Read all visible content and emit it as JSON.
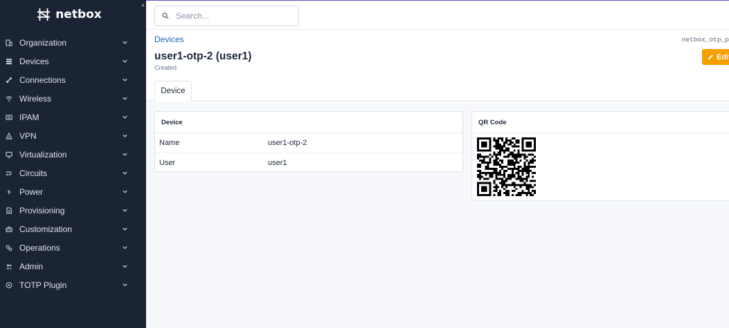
{
  "brand": {
    "name": "netbox"
  },
  "sidebar": {
    "items": [
      {
        "label": "Organization",
        "icon": "building-icon"
      },
      {
        "label": "Devices",
        "icon": "server-icon"
      },
      {
        "label": "Connections",
        "icon": "connection-icon"
      },
      {
        "label": "Wireless",
        "icon": "wifi-icon"
      },
      {
        "label": "IPAM",
        "icon": "counter-icon"
      },
      {
        "label": "VPN",
        "icon": "tunnel-icon"
      },
      {
        "label": "Virtualization",
        "icon": "monitor-icon"
      },
      {
        "label": "Circuits",
        "icon": "transit-icon"
      },
      {
        "label": "Power",
        "icon": "flash-icon"
      },
      {
        "label": "Provisioning",
        "icon": "file-document-icon"
      },
      {
        "label": "Customization",
        "icon": "toolbox-icon"
      },
      {
        "label": "Operations",
        "icon": "cogs-icon"
      },
      {
        "label": "Admin",
        "icon": "account-multiple-icon"
      },
      {
        "label": "TOTP Plugin",
        "icon": "shield-icon"
      }
    ]
  },
  "search": {
    "placeholder": "Search..."
  },
  "breadcrumb": {
    "label": "Devices"
  },
  "page": {
    "title": "user1-otp-2 (user1)",
    "subtitle": "Created",
    "model_label": "netbox_otp_p",
    "edit_label": "Edit"
  },
  "tabs": [
    {
      "label": "Device"
    }
  ],
  "device_card": {
    "title": "Device",
    "rows": [
      {
        "key": "Name",
        "value": "user1-otp-2"
      },
      {
        "key": "User",
        "value": "user1"
      }
    ]
  },
  "qr_card": {
    "title": "QR Code"
  },
  "colors": {
    "sidebar_bg": "#1b2434",
    "accent": "#f59f00",
    "link": "#1f66b3",
    "top_border": "#6a49c4"
  }
}
